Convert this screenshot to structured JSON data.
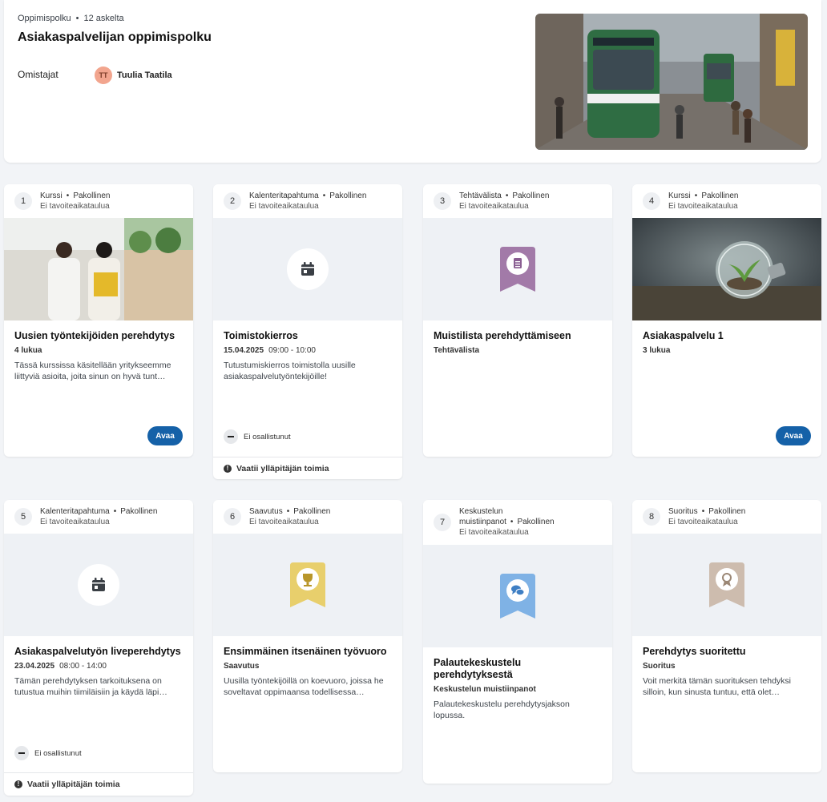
{
  "header": {
    "breadcrumb_type": "Oppimispolku",
    "breadcrumb_count": "12 askelta",
    "title": "Asiakaspalvelijan oppimispolku",
    "owners_label": "Omistajat",
    "owner_initials": "TT",
    "owner_name": "Tuulia Taatila"
  },
  "common": {
    "required": "Pakollinen",
    "no_schedule": "Ei tavoiteaikataulua",
    "open_label": "Avaa",
    "not_attended": "Ei osallistunut",
    "admin_needed": "Vaatii ylläpitäjän toimia"
  },
  "steps": [
    {
      "num": "1",
      "type": "Kurssi",
      "title": "Uusien työntekijöiden perehdytys",
      "sub": "4 lukua",
      "desc": "Tässä kurssissa käsitellään yritykseemme liittyviä asioita, joita sinun on hyvä tunt…"
    },
    {
      "num": "2",
      "type": "Kalenteritapahtuma",
      "title": "Toimistokierros",
      "date": "15.04.2025",
      "time": "09:00  -  10:00",
      "desc": "Tutustumiskierros toimistolla uusille asiakaspalvelutyöntekijöille!"
    },
    {
      "num": "3",
      "type": "Tehtävälista",
      "title": "Muistilista perehdyttämiseen",
      "sub": "Tehtävälista"
    },
    {
      "num": "4",
      "type": "Kurssi",
      "title": "Asiakaspalvelu 1",
      "sub": "3 lukua"
    },
    {
      "num": "5",
      "type": "Kalenteritapahtuma",
      "title": "Asiakaspalvelutyön liveperehdytys",
      "date": "23.04.2025",
      "time": "08:00  -  14:00",
      "desc": "Tämän perehdytyksen tarkoituksena on tutustua muihin tiimiläisiin ja käydä läpi…"
    },
    {
      "num": "6",
      "type": "Saavutus",
      "title": "Ensimmäinen itsenäinen työvuoro",
      "sub": "Saavutus",
      "desc": "Uusilla työntekijöillä on koevuoro, joissa he soveltavat oppimaansa todellisessa…"
    },
    {
      "num": "7",
      "type_line1": "Keskustelun",
      "type_line2": "muistiinpanot",
      "title": "Palautekeskustelu perehdytyksestä",
      "sub": "Keskustelun muistiinpanot",
      "desc": "Palautekeskustelu perehdytysjakson lopussa."
    },
    {
      "num": "8",
      "type": "Suoritus",
      "title": "Perehdytys suoritettu",
      "sub": "Suoritus",
      "desc": "Voit merkitä tämän suorituksen tehdyksi silloin, kun sinusta tuntuu, että olet…"
    }
  ],
  "icons": {
    "calendar": "calendar-icon",
    "checklist": "checklist-ribbon-icon",
    "trophy": "trophy-ribbon-icon",
    "chat": "chat-ribbon-icon",
    "award": "award-ribbon-icon"
  },
  "colors": {
    "primary": "#1561a8",
    "checklist": "#a27aa8",
    "trophy": "#e8cf6c",
    "chat": "#7fb2e5",
    "award": "#cdbcae"
  }
}
